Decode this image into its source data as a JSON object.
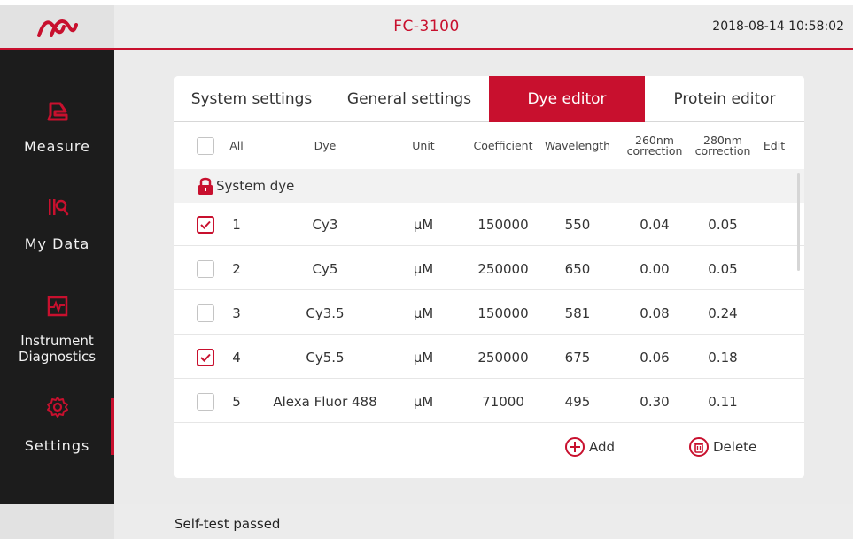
{
  "header": {
    "title": "FC-3100",
    "datetime": "2018-08-14 10:58:02",
    "logo_icon": "brand-logo-icon"
  },
  "sidebar": {
    "items": [
      {
        "label": "Measure",
        "icon": "measure-icon"
      },
      {
        "label": "My Data",
        "icon": "my-data-icon"
      },
      {
        "label_line1": "Instrument",
        "label_line2": "Diagnostics",
        "icon": "diagnostics-icon"
      },
      {
        "label": "Settings",
        "icon": "gear-icon",
        "active": true
      }
    ]
  },
  "tabs": [
    {
      "label": "System settings"
    },
    {
      "label": "General settings"
    },
    {
      "label": "Dye editor",
      "active": true
    },
    {
      "label": "Protein editor"
    }
  ],
  "table": {
    "headers": {
      "all": "All",
      "dye": "Dye",
      "unit": "Unit",
      "coefficient": "Coefficient",
      "wavelength": "Wavelength",
      "c260_line1": "260nm",
      "c260_line2": "correction",
      "c280_line1": "280nm",
      "c280_line2": "correction",
      "edit": "Edit"
    },
    "group_label": "System dye",
    "rows": [
      {
        "checked": true,
        "index": "1",
        "dye": "Cy3",
        "unit": "μM",
        "coefficient": "150000",
        "wavelength": "550",
        "c260": "0.04",
        "c280": "0.05"
      },
      {
        "checked": false,
        "index": "2",
        "dye": "Cy5",
        "unit": "μM",
        "coefficient": "250000",
        "wavelength": "650",
        "c260": "0.00",
        "c280": "0.05"
      },
      {
        "checked": false,
        "index": "3",
        "dye": "Cy3.5",
        "unit": "μM",
        "coefficient": "150000",
        "wavelength": "581",
        "c260": "0.08",
        "c280": "0.24"
      },
      {
        "checked": true,
        "index": "4",
        "dye": "Cy5.5",
        "unit": "μM",
        "coefficient": "250000",
        "wavelength": "675",
        "c260": "0.06",
        "c280": "0.18"
      },
      {
        "checked": false,
        "index": "5",
        "dye": "Alexa Fluor 488",
        "unit": "μM",
        "coefficient": "71000",
        "wavelength": "495",
        "c260": "0.30",
        "c280": "0.11"
      }
    ]
  },
  "actions": {
    "add_label": "Add",
    "delete_label": "Delete"
  },
  "status": {
    "message": "Self-test passed"
  },
  "colors": {
    "accent": "#c8102e",
    "sidebar_bg": "#1c1c1c",
    "main_bg": "#ebebeb"
  }
}
